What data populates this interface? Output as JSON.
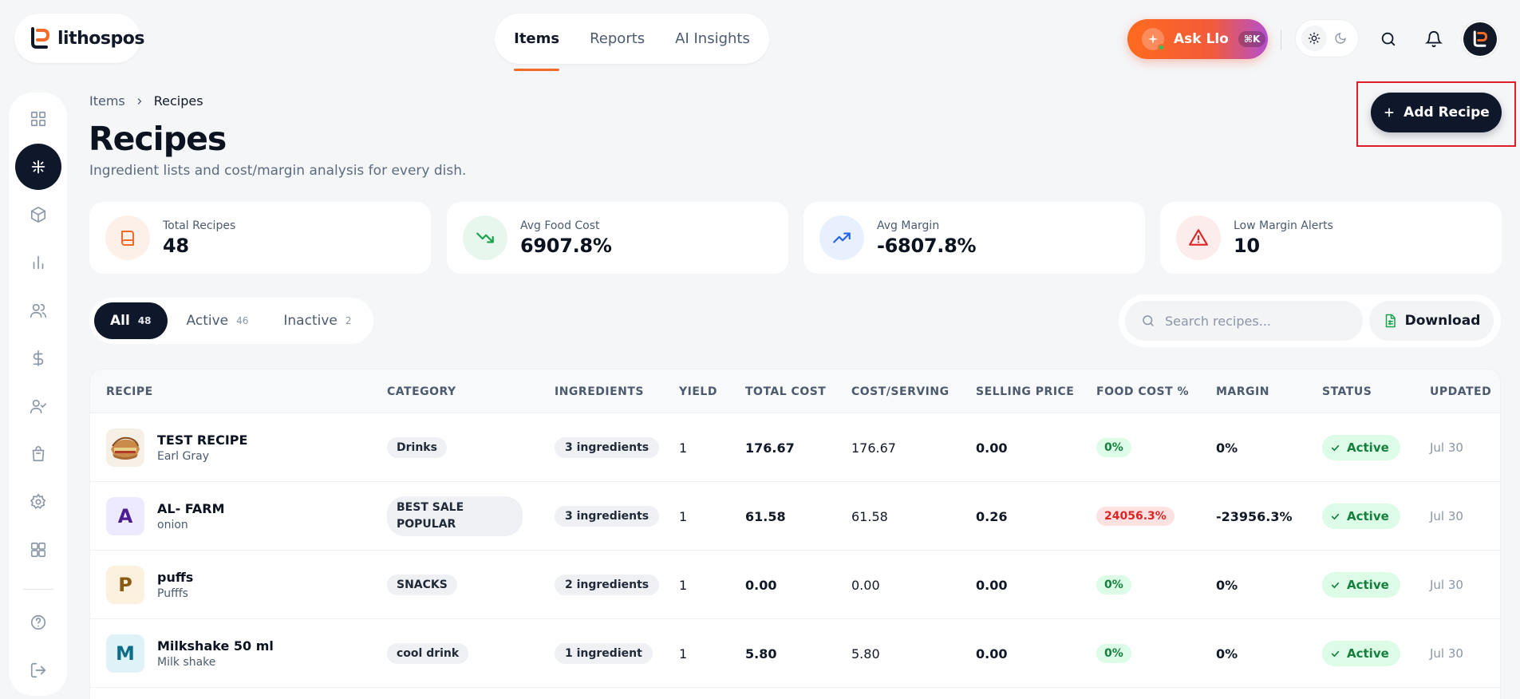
{
  "brand": {
    "name": "lithospos"
  },
  "nav": {
    "tabs": [
      {
        "label": "Items",
        "active": true
      },
      {
        "label": "Reports",
        "active": false
      },
      {
        "label": "AI Insights",
        "active": false
      }
    ]
  },
  "topbar": {
    "ask_label": "Ask Llo",
    "ask_shortcut": "⌘K",
    "icons": [
      "sun-icon",
      "moon-icon",
      "search-icon",
      "bell-icon",
      "avatar"
    ]
  },
  "sidebar": {
    "items": [
      {
        "icon": "dashboard-grid-icon",
        "active": false
      },
      {
        "icon": "recipes-icon",
        "active": true
      },
      {
        "icon": "box-icon",
        "active": false
      },
      {
        "icon": "bar-chart-icon",
        "active": false
      },
      {
        "icon": "users-icon",
        "active": false
      },
      {
        "icon": "dollar-icon",
        "active": false
      },
      {
        "icon": "user-check-icon",
        "active": false
      },
      {
        "icon": "shopping-bag-icon",
        "active": false
      },
      {
        "icon": "settings-gear-icon",
        "active": false
      },
      {
        "icon": "apps-grid-icon",
        "active": false
      }
    ],
    "bottom": [
      {
        "icon": "help-icon"
      },
      {
        "icon": "logout-icon"
      }
    ]
  },
  "breadcrumb": {
    "parent": "Items",
    "separator": ">",
    "current": "Recipes"
  },
  "page": {
    "title": "Recipes",
    "subtitle": "Ingredient lists and cost/margin analysis for every dish.",
    "add_button": "Add Recipe"
  },
  "stats": [
    {
      "label": "Total Recipes",
      "value": "48",
      "icon": "book-icon",
      "color": "#f26b2c"
    },
    {
      "label": "Avg Food Cost",
      "value": "6907.8%",
      "icon": "trending-down-icon",
      "color": "#16a34a"
    },
    {
      "label": "Avg Margin",
      "value": "-6807.8%",
      "icon": "trending-up-icon",
      "color": "#2563eb"
    },
    {
      "label": "Low Margin Alerts",
      "value": "10",
      "icon": "alert-triangle-icon",
      "color": "#dc2626"
    }
  ],
  "filters": [
    {
      "label": "All",
      "count": "48",
      "active": true
    },
    {
      "label": "Active",
      "count": "46",
      "active": false
    },
    {
      "label": "Inactive",
      "count": "2",
      "active": false
    }
  ],
  "search": {
    "placeholder": "Search recipes...",
    "value": ""
  },
  "download_label": "Download",
  "table": {
    "columns": [
      "RECIPE",
      "CATEGORY",
      "INGREDIENTS",
      "YIELD",
      "TOTAL COST",
      "COST/SERVING",
      "SELLING PRICE",
      "FOOD COST %",
      "MARGIN",
      "STATUS",
      "UPDATED"
    ],
    "rows": [
      {
        "name": "TEST RECIPE",
        "sub": "Earl Gray",
        "thumb": "",
        "thumb_type": "image",
        "category": "Drinks",
        "ingredients": "3 ingredients",
        "yield": "1",
        "total_cost": "176.67",
        "cost_serving": "176.67",
        "selling_price": "0.00",
        "food_cost": "0%",
        "food_cost_status": "ok",
        "margin": "0%",
        "status": "Active",
        "updated": "Jul 30"
      },
      {
        "name": "AL- FARM",
        "sub": "onion",
        "thumb": "A",
        "thumb_type": "letter",
        "thumb_bg": "#ede9fe",
        "thumb_fg": "#4c1d95",
        "category": "BEST SALE POPULAR",
        "ingredients": "3 ingredients",
        "yield": "1",
        "total_cost": "61.58",
        "cost_serving": "61.58",
        "selling_price": "0.26",
        "food_cost": "24056.3%",
        "food_cost_status": "bad",
        "margin": "-23956.3%",
        "status": "Active",
        "updated": "Jul 30"
      },
      {
        "name": "puffs",
        "sub": "Pufffs",
        "thumb": "P",
        "thumb_type": "letter",
        "thumb_bg": "#fbf1de",
        "thumb_fg": "#8a5a12",
        "category": "SNACKS",
        "ingredients": "2 ingredients",
        "yield": "1",
        "total_cost": "0.00",
        "cost_serving": "0.00",
        "selling_price": "0.00",
        "food_cost": "0%",
        "food_cost_status": "ok",
        "margin": "0%",
        "status": "Active",
        "updated": "Jul 30"
      },
      {
        "name": "Milkshake 50 ml",
        "sub": "Milk shake",
        "thumb": "M",
        "thumb_type": "letter",
        "thumb_bg": "#dff2f7",
        "thumb_fg": "#0e6e8a",
        "category": "cool drink",
        "ingredients": "1 ingredient",
        "yield": "1",
        "total_cost": "5.80",
        "cost_serving": "5.80",
        "selling_price": "0.00",
        "food_cost": "0%",
        "food_cost_status": "ok",
        "margin": "0%",
        "status": "Active",
        "updated": "Jul 30"
      }
    ]
  }
}
